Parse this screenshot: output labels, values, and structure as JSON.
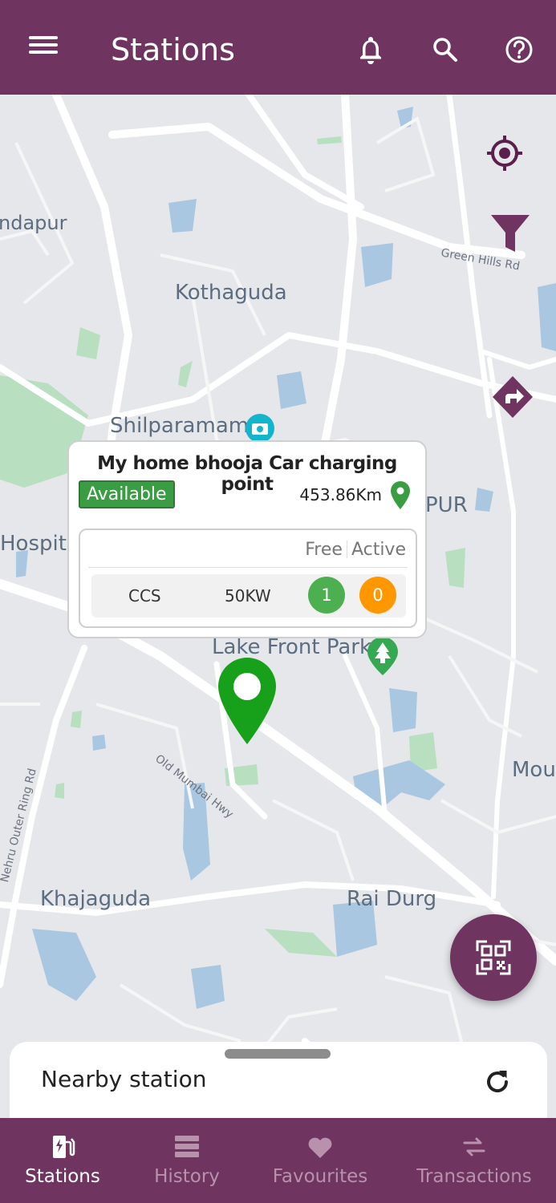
{
  "header": {
    "title": "Stations",
    "icons": [
      "menu-icon",
      "bell-icon",
      "search-icon",
      "help-icon"
    ]
  },
  "map": {
    "labels": {
      "ndapur": "ndapur",
      "kothaguda": "Kothaguda",
      "green_hills": "Green Hills Rd",
      "shilparamam": "Shilparamam",
      "pur": "PUR",
      "hospit": "Hospit",
      "lake_front_park": "Lake Front Park",
      "old_mumbai_hwy": "Old Mumbai Hwy",
      "nehru_outer_ring": "Nehru Outer Ring Rd",
      "mou": "Mou",
      "khajaguda": "Khajaguda",
      "rai_durg": "Rai Durg"
    },
    "controls": [
      "locate-icon",
      "filter-icon",
      "directions-icon"
    ]
  },
  "popup": {
    "station_name": "My home bhooja Car charging point",
    "status": "Available",
    "distance": "453.86Km",
    "col_free": "Free",
    "col_active": "Active",
    "connector_type": "CCS",
    "power": "50KW",
    "free_count": "1",
    "active_count": "0"
  },
  "sheet": {
    "title": "Nearby station"
  },
  "nav": {
    "items": [
      {
        "label": "Stations",
        "icon": "charging-station-icon",
        "active": true
      },
      {
        "label": "History",
        "icon": "history-icon",
        "active": false
      },
      {
        "label": "Favourites",
        "icon": "heart-icon",
        "active": false
      },
      {
        "label": "Transactions",
        "icon": "swap-icon",
        "active": false
      }
    ]
  },
  "colors": {
    "primary": "#6f3460",
    "available": "#3b9d43",
    "free_badge": "#4caf50",
    "active_badge": "#ff9800",
    "marker": "#17a01a"
  }
}
